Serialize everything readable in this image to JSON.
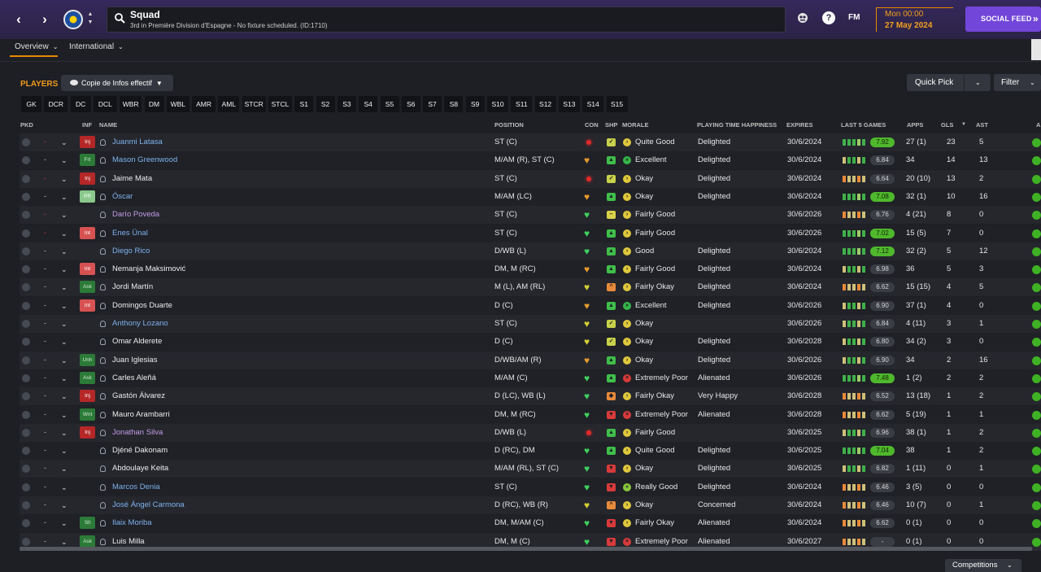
{
  "header": {
    "title": "Squad",
    "subtitle": "3rd in Première Division d'Espagne - No fixture scheduled. (ID:1710)",
    "date_time": "Mon 00:00",
    "date": "27 May 2024",
    "social_label": "SOCIAL FEED",
    "fm_label": "FM",
    "help_label": "?",
    "back_icon": "chevron-left-icon",
    "forward_icon": "chevron-right-icon"
  },
  "tabs": [
    {
      "label": "Overview"
    },
    {
      "label": "International"
    }
  ],
  "toolbar": {
    "section_label": "PLAYERS",
    "view_label": "Copie de Infos effectif",
    "quick_pick_label": "Quick Pick",
    "filter_label": "Filter"
  },
  "position_filters": [
    "GK",
    "DCR",
    "DC",
    "DCL",
    "WBR",
    "DM",
    "WBL",
    "AMR",
    "AML",
    "STCR",
    "STCL",
    "S1",
    "S2",
    "S3",
    "S4",
    "S5",
    "S6",
    "S7",
    "S8",
    "S9",
    "S10",
    "S11",
    "S12",
    "S13",
    "S14",
    "S15"
  ],
  "columns": {
    "pkd": "PKD",
    "inf": "INF",
    "name": "NAME",
    "position": "POSITION",
    "con": "CON",
    "shp": "SHP",
    "morale": "MORALE",
    "pth": "PLAYING TIME HAPPINESS",
    "expires": "EXPIRES",
    "last5": "LAST 5 GAMES",
    "apps": "APPS",
    "gls": "GLS",
    "ast": "AST",
    "extra": "A"
  },
  "colors": {
    "accent": "#e98a00",
    "social": "#7246d8",
    "rating_high": "#4fb82c",
    "name_blue": "#7fb1ee",
    "name_purple": "#c39be5"
  },
  "players": [
    {
      "inf": "Inj",
      "name": "Juanmi Latasa",
      "position": "ST (C)",
      "con": "injured",
      "shp": "ok",
      "morale": "Quite Good",
      "pth": "Delighted",
      "expires": "30/6/2024",
      "rating": "7.92",
      "rating_high": true,
      "apps": "27 (1)",
      "gls": "23",
      "ast": "5",
      "dash_red": true
    },
    {
      "inf": "Frt",
      "name": "Mason Greenwood",
      "position": "M/AM (R), ST (C)",
      "con": "orange",
      "shp": "good",
      "morale": "Excellent",
      "pth": "Delighted",
      "expires": "30/6/2024",
      "rating": "6.84",
      "rating_high": false,
      "apps": "34",
      "gls": "14",
      "ast": "13",
      "dash_red": false
    },
    {
      "inf": "Inj",
      "name": "Jaime Mata",
      "position": "ST (C)",
      "con": "injured",
      "shp": "ok",
      "morale": "Okay",
      "pth": "Delighted",
      "expires": "30/6/2024",
      "rating": "6.64",
      "rating_high": false,
      "apps": "20 (10)",
      "gls": "13",
      "ast": "2",
      "dash_red": true
    },
    {
      "inf": "PR",
      "name": "Óscar",
      "position": "M/AM (LC)",
      "con": "orange",
      "shp": "good",
      "morale": "Okay",
      "pth": "Delighted",
      "expires": "30/6/2024",
      "rating": "7.08",
      "rating_high": true,
      "apps": "32 (1)",
      "gls": "10",
      "ast": "16",
      "dash_red": false
    },
    {
      "inf": "",
      "name": "Darío Poveda",
      "position": "ST (C)",
      "con": "green",
      "shp": "neutral",
      "morale": "Fairly Good",
      "pth": "",
      "expires": "30/6/2026",
      "rating": "6.76",
      "rating_high": false,
      "apps": "4 (21)",
      "gls": "8",
      "ast": "0",
      "dash_red": true
    },
    {
      "inf": "Int",
      "name": "Enes Ünal",
      "position": "ST (C)",
      "con": "green",
      "shp": "good",
      "morale": "Fairly Good",
      "pth": "",
      "expires": "30/6/2026",
      "rating": "7.02",
      "rating_high": true,
      "apps": "15 (5)",
      "gls": "7",
      "ast": "0",
      "dash_red": true
    },
    {
      "inf": "",
      "name": "Diego Rico",
      "position": "D/WB (L)",
      "con": "green",
      "shp": "good",
      "morale": "Good",
      "pth": "Delighted",
      "expires": "30/6/2024",
      "rating": "7.12",
      "rating_high": true,
      "apps": "32 (2)",
      "gls": "5",
      "ast": "12",
      "dash_red": false
    },
    {
      "inf": "Int",
      "name": "Nemanja Maksimović",
      "position": "DM, M (RC)",
      "con": "orange",
      "shp": "good",
      "morale": "Fairly Good",
      "pth": "Delighted",
      "expires": "30/6/2024",
      "rating": "6.98",
      "rating_high": false,
      "apps": "36",
      "gls": "5",
      "ast": "3",
      "dash_red": false
    },
    {
      "inf": "Ask",
      "name": "Jordi Martín",
      "position": "M (L), AM (RL)",
      "con": "yellow",
      "shp": "up",
      "morale": "Fairly Okay",
      "pth": "Delighted",
      "expires": "30/6/2024",
      "rating": "6.62",
      "rating_high": false,
      "apps": "15 (15)",
      "gls": "4",
      "ast": "5",
      "dash_red": false
    },
    {
      "inf": "Int",
      "name": "Domingos Duarte",
      "position": "D (C)",
      "con": "orange",
      "shp": "good",
      "morale": "Excellent",
      "pth": "Delighted",
      "expires": "30/6/2026",
      "rating": "6.90",
      "rating_high": false,
      "apps": "37 (1)",
      "gls": "4",
      "ast": "0",
      "dash_red": false
    },
    {
      "inf": "",
      "name": "Anthony Lozano",
      "position": "ST (C)",
      "con": "yellow",
      "shp": "ok",
      "morale": "Okay",
      "pth": "",
      "expires": "30/6/2026",
      "rating": "6.84",
      "rating_high": false,
      "apps": "4 (11)",
      "gls": "3",
      "ast": "1",
      "dash_red": false
    },
    {
      "inf": "",
      "name": "Omar Alderete",
      "position": "D (C)",
      "con": "yellow",
      "shp": "ok",
      "morale": "Okay",
      "pth": "Delighted",
      "expires": "30/6/2028",
      "rating": "6.80",
      "rating_high": false,
      "apps": "34 (2)",
      "gls": "3",
      "ast": "0",
      "dash_red": false
    },
    {
      "inf": "Unh",
      "name": "Juan Iglesias",
      "position": "D/WB/AM (R)",
      "con": "orange",
      "shp": "good",
      "morale": "Okay",
      "pth": "Delighted",
      "expires": "30/6/2026",
      "rating": "6.90",
      "rating_high": false,
      "apps": "34",
      "gls": "2",
      "ast": "16",
      "dash_red": false
    },
    {
      "inf": "Ask",
      "name": "Carles Aleñá",
      "position": "M/AM (C)",
      "con": "green",
      "shp": "good",
      "morale": "Extremely Poor",
      "pth": "Alienated",
      "expires": "30/6/2026",
      "rating": "7.48",
      "rating_high": true,
      "apps": "1 (2)",
      "gls": "2",
      "ast": "2",
      "dash_red": false
    },
    {
      "inf": "Inj",
      "name": "Gastón Álvarez",
      "position": "D (LC), WB (L)",
      "con": "green",
      "shp": "orange",
      "morale": "Fairly Okay",
      "pth": "Very Happy",
      "expires": "30/6/2028",
      "rating": "6.52",
      "rating_high": false,
      "apps": "13 (18)",
      "gls": "1",
      "ast": "2",
      "dash_red": false
    },
    {
      "inf": "Wnt",
      "name": "Mauro Arambarri",
      "position": "DM, M (RC)",
      "con": "green",
      "shp": "bad",
      "morale": "Extremely Poor",
      "pth": "Alienated",
      "expires": "30/6/2028",
      "rating": "6.62",
      "rating_high": false,
      "apps": "5 (19)",
      "gls": "1",
      "ast": "1",
      "dash_red": false
    },
    {
      "inf": "Inj",
      "name": "Jonathan Silva",
      "position": "D/WB (L)",
      "con": "injured",
      "shp": "good",
      "morale": "Fairly Good",
      "pth": "",
      "expires": "30/6/2025",
      "rating": "6.96",
      "rating_high": false,
      "apps": "38 (1)",
      "gls": "1",
      "ast": "2",
      "dash_red": false
    },
    {
      "inf": "",
      "name": "Djéné Dakonam",
      "position": "D (RC), DM",
      "con": "green",
      "shp": "good",
      "morale": "Quite Good",
      "pth": "Delighted",
      "expires": "30/6/2025",
      "rating": "7.04",
      "rating_high": true,
      "apps": "38",
      "gls": "1",
      "ast": "2",
      "dash_red": false
    },
    {
      "inf": "",
      "name": "Abdoulaye Keita",
      "position": "M/AM (RL), ST (C)",
      "con": "green",
      "shp": "bad",
      "morale": "Okay",
      "pth": "Delighted",
      "expires": "30/6/2025",
      "rating": "6.82",
      "rating_high": false,
      "apps": "1 (11)",
      "gls": "0",
      "ast": "1",
      "dash_red": false
    },
    {
      "inf": "",
      "name": "Marcos Denia",
      "position": "ST (C)",
      "con": "green",
      "shp": "bad",
      "morale": "Really Good",
      "pth": "Delighted",
      "expires": "30/6/2024",
      "rating": "6.46",
      "rating_high": false,
      "apps": "3 (5)",
      "gls": "0",
      "ast": "0",
      "dash_red": false
    },
    {
      "inf": "",
      "name": "José Ángel Carmona",
      "position": "D (RC), WB (R)",
      "con": "yellow",
      "shp": "up",
      "morale": "Okay",
      "pth": "Concerned",
      "expires": "30/6/2024",
      "rating": "6.46",
      "rating_high": false,
      "apps": "10 (7)",
      "gls": "0",
      "ast": "1",
      "dash_red": false
    },
    {
      "inf": "Slt",
      "name": "Ilaix Moriba",
      "position": "DM, M/AM (C)",
      "con": "green",
      "shp": "bad",
      "morale": "Fairly Okay",
      "pth": "Alienated",
      "expires": "30/6/2024",
      "rating": "6.62",
      "rating_high": false,
      "apps": "0 (1)",
      "gls": "0",
      "ast": "0",
      "dash_red": false
    },
    {
      "inf": "Ask",
      "name": "Luis Milla",
      "position": "DM, M (C)",
      "con": "green",
      "shp": "bad",
      "morale": "Extremely Poor",
      "pth": "Alienated",
      "expires": "30/6/2027",
      "rating": "-",
      "rating_high": false,
      "apps": "0 (1)",
      "gls": "0",
      "ast": "0",
      "dash_red": false
    }
  ],
  "footer": {
    "competitions_label": "Competitions"
  }
}
